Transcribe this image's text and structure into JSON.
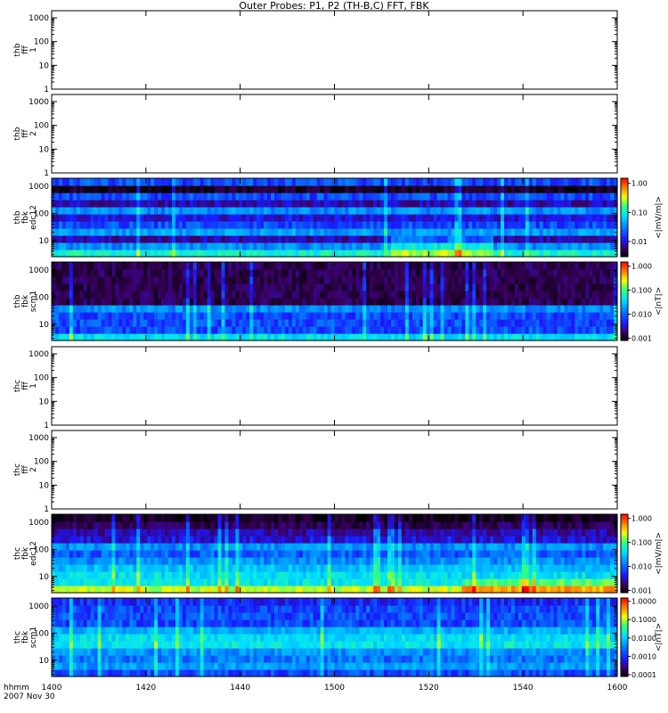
{
  "title": "Outer Probes: P1, P2 (TH-B,C) FFT, FBK",
  "colors": {
    "frame": "#000000",
    "background": "#ffffff"
  },
  "chart_data": [
    {
      "type": "heatmap",
      "panel": "thb_fff_1",
      "ylabel": [
        "thb",
        "fff",
        "1"
      ],
      "y_scale": "log",
      "ylim": [
        1,
        2000
      ],
      "yticks": [
        "1",
        "10",
        "100",
        "1000"
      ],
      "data_present": false
    },
    {
      "type": "heatmap",
      "panel": "thb_fff_2",
      "ylabel": [
        "thb",
        "fff",
        "2"
      ],
      "y_scale": "log",
      "ylim": [
        1,
        2000
      ],
      "yticks": [
        "1",
        "10",
        "100",
        "1000"
      ],
      "data_present": false
    },
    {
      "type": "heatmap",
      "panel": "thb_fbk_edc12",
      "ylabel": [
        "thb",
        "fbk",
        "edc12"
      ],
      "y_scale": "log",
      "ylim": [
        2.5,
        2000
      ],
      "yticks": [
        "10",
        "100",
        "1000"
      ],
      "data_present": true,
      "colorbar": {
        "label": "<|mV/m|>",
        "scale": "log",
        "range": [
          0.003,
          1.5
        ],
        "ticks": [
          "0.01",
          "0.10",
          "1.00"
        ]
      }
    },
    {
      "type": "heatmap",
      "panel": "thb_fbk_scm1",
      "ylabel": [
        "thb",
        "fbk",
        "scm1"
      ],
      "y_scale": "log",
      "ylim": [
        2.5,
        2000
      ],
      "yticks": [
        "10",
        "100",
        "1000"
      ],
      "data_present": true,
      "colorbar": {
        "label": "<|nT|>",
        "scale": "log",
        "range": [
          0.0008,
          1.5
        ],
        "ticks": [
          "0.001",
          "0.010",
          "0.100",
          "1.000"
        ]
      }
    },
    {
      "type": "heatmap",
      "panel": "thc_fff_1",
      "ylabel": [
        "thc",
        "fff",
        "1"
      ],
      "y_scale": "log",
      "ylim": [
        1,
        2000
      ],
      "yticks": [
        "1",
        "10",
        "100",
        "1000"
      ],
      "data_present": false
    },
    {
      "type": "heatmap",
      "panel": "thc_fff_2",
      "ylabel": [
        "thc",
        "fff",
        "2"
      ],
      "y_scale": "log",
      "ylim": [
        1,
        2000
      ],
      "yticks": [
        "1",
        "10",
        "100",
        "1000"
      ],
      "data_present": false
    },
    {
      "type": "heatmap",
      "panel": "thc_fbk_edc12",
      "ylabel": [
        "thc",
        "fbk",
        "edc12"
      ],
      "y_scale": "log",
      "ylim": [
        2.5,
        2000
      ],
      "yticks": [
        "10",
        "100",
        "1000"
      ],
      "data_present": true,
      "colorbar": {
        "label": "<|mV/m|>",
        "scale": "log",
        "range": [
          0.0008,
          1.5
        ],
        "ticks": [
          "0.001",
          "0.010",
          "0.100",
          "1.000"
        ]
      }
    },
    {
      "type": "heatmap",
      "panel": "thc_fbk_scm1",
      "ylabel": [
        "thc",
        "fbk",
        "scm1"
      ],
      "y_scale": "log",
      "ylim": [
        2.5,
        2000
      ],
      "yticks": [
        "10",
        "100",
        "1000"
      ],
      "data_present": true,
      "colorbar": {
        "label": "<|nT|>",
        "scale": "log",
        "range": [
          8e-05,
          1.5
        ],
        "ticks": [
          "0.0001",
          "0.0010",
          "0.0100",
          "0.1000",
          "1.0000"
        ]
      }
    }
  ],
  "x_axis": {
    "ticks": [
      "1400",
      "1420",
      "1440",
      "1500",
      "1520",
      "1540",
      "1600"
    ],
    "label_line1": "hhmm",
    "label_line2": "2007 Nov 30"
  }
}
